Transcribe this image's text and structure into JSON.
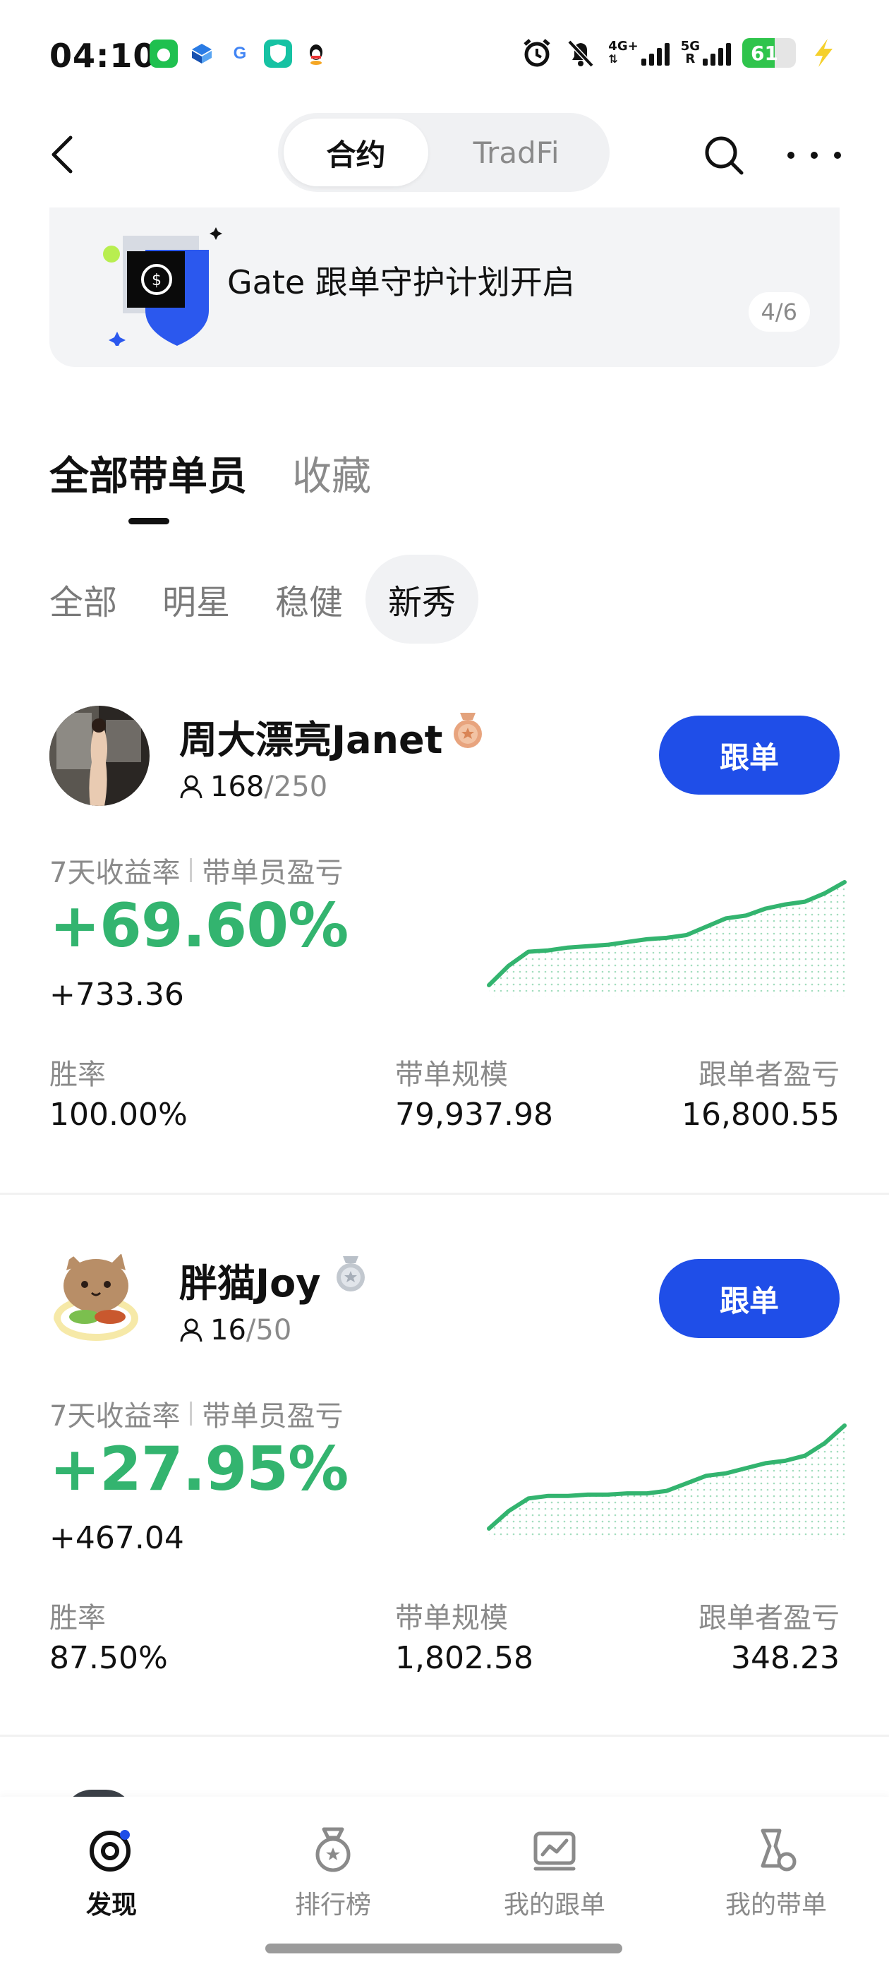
{
  "status_bar": {
    "time": "04:10",
    "network_1": "4G+",
    "network_2": "5G",
    "roaming": "R",
    "battery": "61",
    "battery_level": 0.61
  },
  "header": {
    "tabs": [
      {
        "label": "合约",
        "active": true
      },
      {
        "label": "TradFi",
        "active": false
      }
    ]
  },
  "banner": {
    "text": "Gate 跟单守护计划开启",
    "page": "4/6"
  },
  "main_tabs": [
    {
      "label": "全部带单员",
      "active": true
    },
    {
      "label": "收藏",
      "active": false
    }
  ],
  "filters": [
    {
      "label": "全部",
      "active": false
    },
    {
      "label": "明星",
      "active": false
    },
    {
      "label": "稳健",
      "active": false
    },
    {
      "label": "新秀",
      "active": true
    }
  ],
  "traders": [
    {
      "name": "周大漂亮Janet",
      "badge": "bronze-medal",
      "followers": "168",
      "followers_max": "/250",
      "follow_label": "跟单",
      "roi_label": "7天收益率",
      "pnl_label": "带单员盈亏",
      "roi": "+69.60%",
      "pnl": "+733.36",
      "win_rate_label": "胜率",
      "win_rate": "100.00%",
      "aum_label": "带单规模",
      "aum": "79,937.98",
      "follower_pnl_label": "跟单者盈亏",
      "follower_pnl": "16,800.55",
      "sparkline": [
        0,
        14,
        24,
        25,
        27,
        28,
        29,
        31,
        33,
        34,
        36,
        42,
        48,
        50,
        55,
        58,
        60,
        66,
        74
      ]
    },
    {
      "name": "胖猫Joy",
      "badge": "silver-medal",
      "followers": "16",
      "followers_max": "/50",
      "follow_label": "跟单",
      "roi_label": "7天收益率",
      "pnl_label": "带单员盈亏",
      "roi": "+27.95%",
      "pnl": "+467.04",
      "win_rate_label": "胜率",
      "win_rate": "87.50%",
      "aum_label": "带单规模",
      "aum": "1,802.58",
      "follower_pnl_label": "跟单者盈亏",
      "follower_pnl": "348.23",
      "sparkline": [
        0,
        14,
        24,
        26,
        26,
        27,
        27,
        28,
        28,
        30,
        36,
        42,
        44,
        48,
        52,
        54,
        58,
        68,
        82
      ]
    }
  ],
  "bottom_nav": [
    {
      "label": "发现",
      "icon": "discover-icon",
      "active": true
    },
    {
      "label": "排行榜",
      "icon": "ranking-medal-icon",
      "active": false
    },
    {
      "label": "我的跟单",
      "icon": "my-copy-trades-icon",
      "active": false
    },
    {
      "label": "我的带单",
      "icon": "my-lead-trades-icon",
      "active": false
    }
  ],
  "colors": {
    "accent_blue": "#1f4ee8",
    "profit_green": "#33b46f",
    "muted_text": "#8a8a8a"
  }
}
